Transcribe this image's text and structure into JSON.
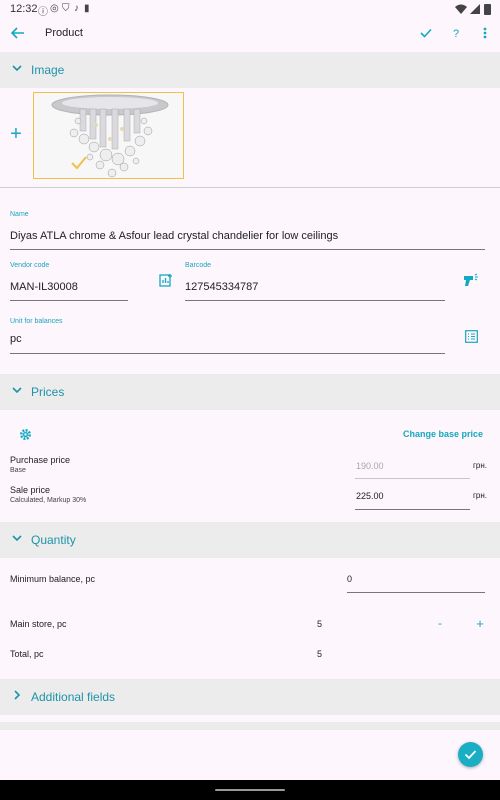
{
  "status_bar": {
    "time": "12:32"
  },
  "app_bar": {
    "title": "Product"
  },
  "sections": {
    "image": "Image",
    "prices": "Prices",
    "quantity": "Quantity",
    "additional": "Additional fields"
  },
  "fields": {
    "name": {
      "label": "Name",
      "value": "Diyas ATLA chrome & Asfour lead crystal chandelier for low ceilings"
    },
    "vendor_code": {
      "label": "Vendor code",
      "value": "MAN-IL30008"
    },
    "barcode": {
      "label": "Barcode",
      "value": "127545334787"
    },
    "unit": {
      "label": "Unit for balances",
      "value": "pc"
    }
  },
  "prices": {
    "change_base_price": "Change base price",
    "purchase": {
      "label": "Purchase price",
      "sub": "Base",
      "value": "190.00",
      "currency": "грн."
    },
    "sale": {
      "label": "Sale price",
      "sub": "Calculated, Markup 30%",
      "value": "225.00",
      "currency": "грн."
    }
  },
  "quantity": {
    "min_balance": {
      "label": "Minimum balance, pc",
      "value": "0"
    },
    "main_store": {
      "label": "Main store, pc",
      "value": "5",
      "minus": "-",
      "plus": "+"
    },
    "total": {
      "label": "Total, pc",
      "value": "5"
    }
  },
  "icons": {
    "back": "arrow-left",
    "check": "check",
    "help": "question-mark",
    "more": "more-vert",
    "add_image": "plus",
    "barcode_gen": "chart-add",
    "scanner": "barcode-scanner",
    "unit_list": "list",
    "settings": "gear"
  },
  "colors": {
    "accent": "#14a9c0",
    "section_bg": "#ececec",
    "background": "#fdf6fc",
    "image_border": "#f2c04a"
  }
}
